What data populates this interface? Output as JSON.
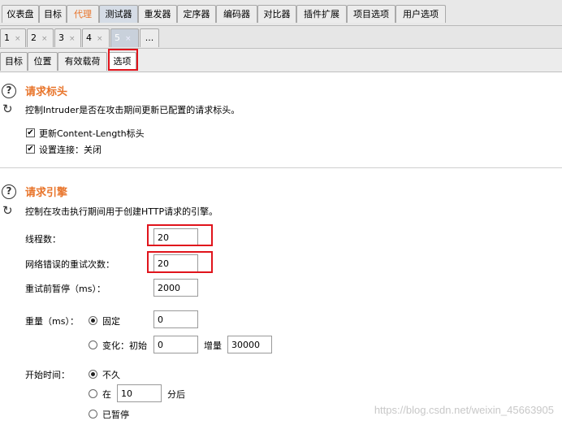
{
  "main_tabs": [
    "仪表盘",
    "目标",
    "代理",
    "测试器",
    "重发器",
    "定序器",
    "编码器",
    "对比器",
    "插件扩展",
    "项目选项",
    "用户选项"
  ],
  "attack_tabs": [
    {
      "label": "1",
      "close": "×"
    },
    {
      "label": "2",
      "close": "×"
    },
    {
      "label": "3",
      "close": "×"
    },
    {
      "label": "4",
      "close": "×"
    },
    {
      "label": "5",
      "close": "×"
    },
    {
      "label": "...",
      "close": ""
    }
  ],
  "sub_tabs": [
    "目标",
    "位置",
    "有效载荷",
    "选项"
  ],
  "request_headers": {
    "title": "请求标头",
    "description": "控制Intruder是否在攻击期间更新已配置的请求标头。",
    "checkboxes": [
      {
        "label": "更新Content-Length标头",
        "checked": true
      },
      {
        "label": "设置连接：关闭",
        "checked": true
      }
    ]
  },
  "request_engine": {
    "title": "请求引擎",
    "description": "控制在攻击执行期间用于创建HTTP请求的引擎。",
    "threads_label": "线程数：",
    "threads_value": "20",
    "retries_label": "网络错误的重试次数：",
    "retries_value": "20",
    "pause_label": "重试前暂停（ms）：",
    "pause_value": "2000",
    "throttle_label": "重量（ms）：",
    "fixed_label": "固定",
    "fixed_value": "0",
    "variable_label": "变化：初始",
    "variable_initial": "0",
    "increment_label": "增量",
    "increment_value": "30000",
    "start_label": "开始时间：",
    "start_now": "不久",
    "start_in": "在",
    "start_in_value": "10",
    "start_in_unit": "分后",
    "start_paused": "已暂停"
  },
  "watermark": "https://blog.csdn.net/weixin_45663905"
}
